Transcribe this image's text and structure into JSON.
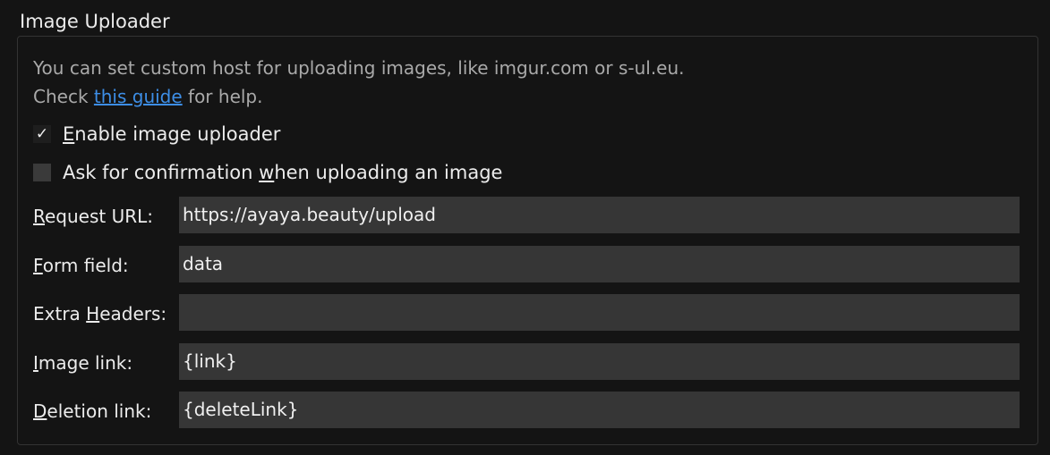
{
  "group": {
    "title": "Image Uploader"
  },
  "description": {
    "line1": "You can set custom host for uploading images, like imgur.com or s-ul.eu.",
    "line2_prefix": "Check ",
    "line2_link": "this guide",
    "line2_suffix": " for help."
  },
  "checkboxes": {
    "enable": {
      "checked": true,
      "mnemonic": "E",
      "rest": "nable image uploader"
    },
    "confirm": {
      "checked": false,
      "before": "Ask for confirmation ",
      "mnemonic": "w",
      "after": "hen uploading an image"
    }
  },
  "fields": {
    "request_url": {
      "label_mnemonic": "R",
      "label_rest": "equest URL:",
      "value": "https://ayaya.beauty/upload"
    },
    "form_field": {
      "label_mnemonic": "F",
      "label_rest": "orm field:",
      "value": "data"
    },
    "extra_headers": {
      "label_before": "Extra ",
      "label_mnemonic": "H",
      "label_rest": "eaders:",
      "value": ""
    },
    "image_link": {
      "label_mnemonic": "I",
      "label_rest": "mage link:",
      "value": "{link}"
    },
    "deletion_link": {
      "label_mnemonic": "D",
      "label_rest": "eletion link:",
      "value": "{deleteLink}"
    }
  },
  "colors": {
    "background": "#141414",
    "input_bg": "#363636",
    "link": "#3d8ee6",
    "description": "#a9a9a9"
  }
}
